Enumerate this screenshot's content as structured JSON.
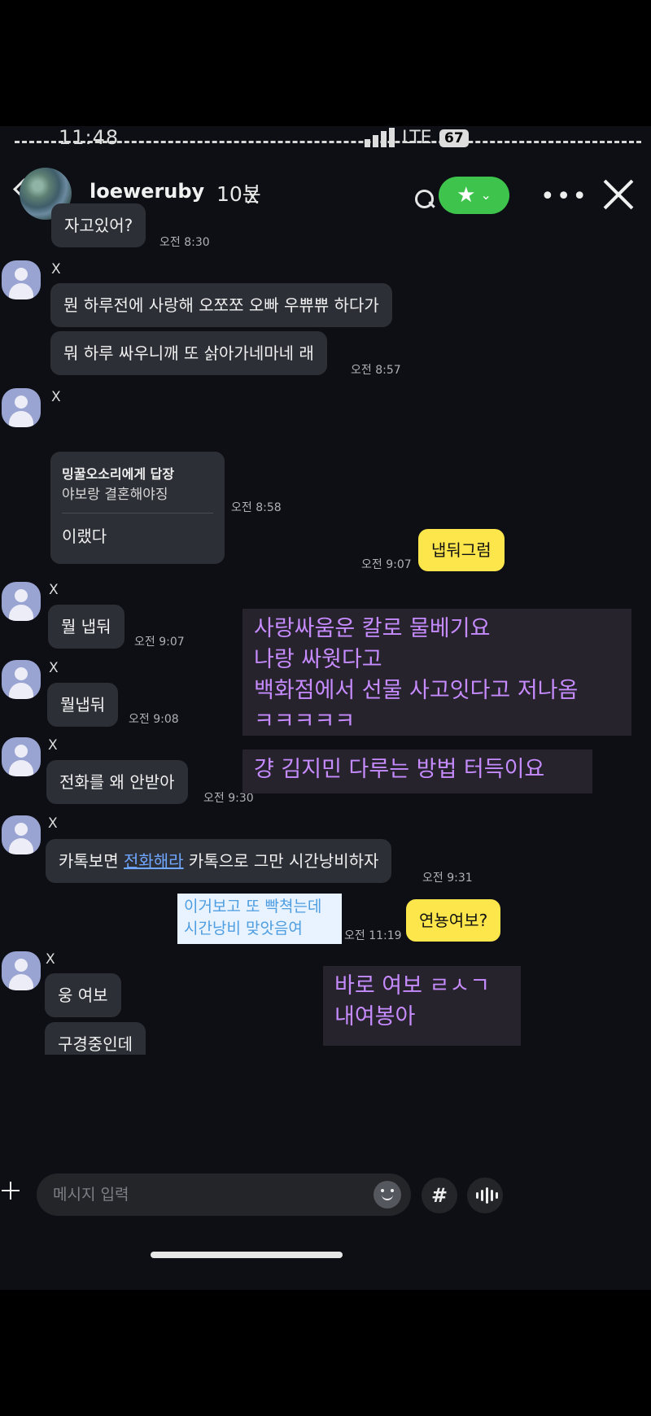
{
  "status": {
    "time": "11:48",
    "network": "LTE",
    "battery": "67"
  },
  "story": {
    "username": "loeweruby",
    "time_ago": "10분",
    "x_mark": "X"
  },
  "messages": [
    {
      "sender": "",
      "text": "자고있어?",
      "time": "오전 8:30"
    },
    {
      "sender": "X",
      "lines": [
        "뭔 하루전에 사랑해 오쪼쪼 오빠 우쀼쀼 하다가",
        "뭐 하루 싸우니깨 또 삵아가네마네 래"
      ],
      "time": "오전 8:57"
    },
    {
      "sender": "X",
      "reply_to": "밍꿀오소리에게 답장",
      "reply_quote": "야보랑 결혼해야징",
      "text": "이랬다",
      "time": "오전 8:58"
    },
    {
      "sender": "me",
      "text": "냅둬그럼",
      "time": "오전 9:07"
    },
    {
      "sender": "X",
      "text": "뭘 냅둬",
      "time": "오전 9:07"
    },
    {
      "sender": "X",
      "text": "뭘냅둬",
      "time": "오전 9:08"
    },
    {
      "sender": "X",
      "text": "전화를 왜 안받아",
      "time": "오전 9:30"
    },
    {
      "sender": "X",
      "text_before": "카톡보면 ",
      "text_link": "전화해라",
      "text_after": " 카톡으로 그만 시간낭비하자",
      "time": "오전 9:31"
    },
    {
      "sender": "me",
      "text": "연뇽여보?",
      "time": "오전 11:19"
    },
    {
      "sender": "X",
      "lines": [
        "웅 여보",
        "구경중인데"
      ]
    }
  ],
  "overlays": {
    "purple1": [
      "사랑싸움운 칼로 물베기요",
      "나랑 싸웟다고",
      "백화점에서 선물 사고잇다고 저나옴",
      "ㅋㅋㅋㅋㅋ"
    ],
    "purple2": [
      "걍 김지민 다루는 방법 터득이요"
    ],
    "purple3": [
      "바로 여보 ㄹㅅㄱ",
      "내여봉아"
    ],
    "blue": [
      "이거보고 또 빡쳑는데",
      "시간낭비 맞앗음여"
    ]
  },
  "composer": {
    "placeholder": "메시지 입력",
    "hash": "#"
  },
  "icons": {
    "back": "chevron-left-icon",
    "search": "search-icon",
    "star": "star-icon",
    "more": "more-dots-icon",
    "close": "close-icon",
    "plus": "plus-icon",
    "emoji": "emoji-icon",
    "hashtag": "hashtag-icon",
    "voice": "voice-wave-icon"
  },
  "colors": {
    "my_bubble": "#fde64b",
    "their_bubble": "#2d2f36",
    "accent_green": "#3ec44c",
    "overlay_purple": "#c58bff",
    "link_blue": "#6fa6ff"
  }
}
